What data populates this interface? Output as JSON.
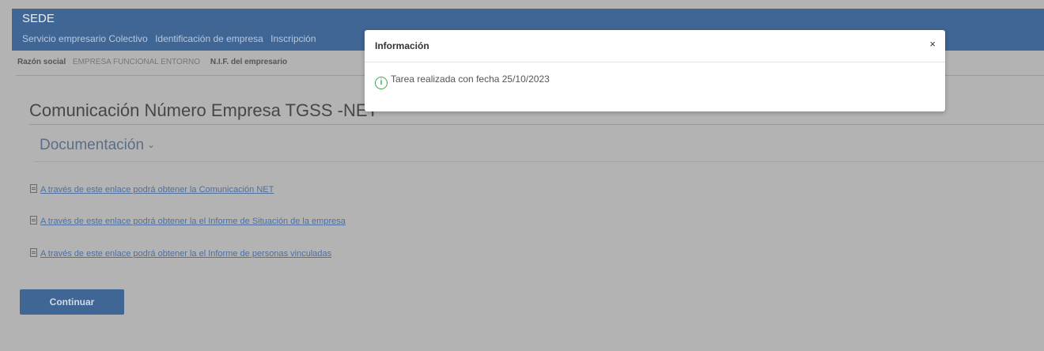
{
  "header": {
    "app_title": "SEDE",
    "breadcrumb": [
      "Servicio empresario Colectivo",
      "Identificación de empresa",
      "Inscripción"
    ]
  },
  "company": {
    "razon_label": "Razón social",
    "razon_value": "EMPRESA FUNCIONAL ENTORNO",
    "nif_label": "N.I.F. del empresario"
  },
  "main": {
    "title": "Comunicación Número Empresa TGSS -NET",
    "section_label": "Documentación",
    "links": [
      "A través de este enlace podrá obtener la Comunicación NET",
      "A través de este enlace podrá obtener la el Informe de Situación de la empresa",
      "A través de este enlace podrá obtener la el Informe de personas vinculadas"
    ],
    "continue_label": "Continuar"
  },
  "modal": {
    "title": "Información",
    "close": "×",
    "message": "Tarea realizada con fecha 25/10/2023"
  },
  "icons": {
    "info": "info-circle-icon",
    "document": "document-icon",
    "chevron": "chevron-down-icon",
    "close": "close-icon"
  },
  "colors": {
    "header_bg": "#3f6694",
    "overlay_bg": "#b3b3b3",
    "link": "#4d6fa0",
    "info_green": "#3aa657"
  }
}
